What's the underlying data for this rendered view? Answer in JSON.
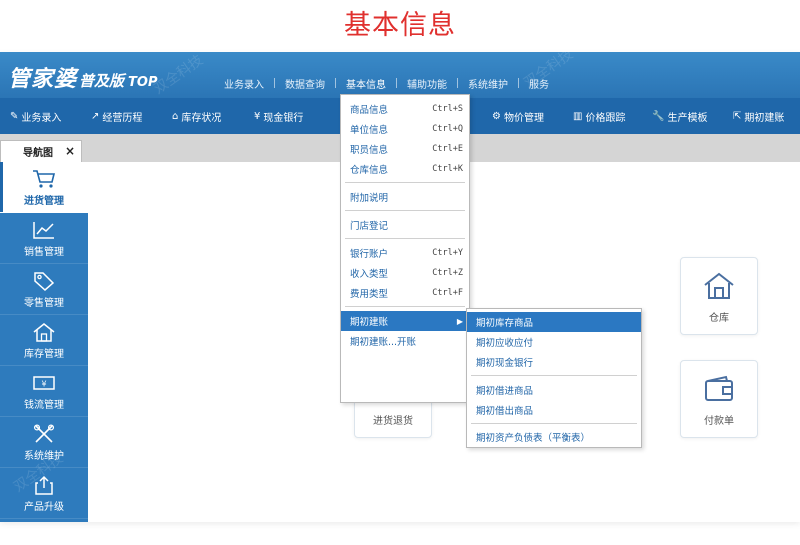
{
  "caption": "基本信息",
  "brand": {
    "main": "管家婆",
    "sub": "普及版",
    "top": "TOP"
  },
  "menubar": [
    "业务录入",
    "数据查询",
    "基本信息",
    "辅助功能",
    "系统维护",
    "服务"
  ],
  "toolbar": [
    {
      "label": "业务录入",
      "icon": "business-entry-icon"
    },
    {
      "label": "经营历程",
      "icon": "trend-icon"
    },
    {
      "label": "库存状况",
      "icon": "home-icon"
    },
    {
      "label": "现金银行",
      "icon": "yen-icon"
    },
    {
      "label": "物价管理",
      "icon": "gear-icon"
    },
    {
      "label": "价格跟踪",
      "icon": "bar-chart-icon"
    },
    {
      "label": "生产模板",
      "icon": "wrench-icon"
    },
    {
      "label": "期初建账",
      "icon": "export-icon"
    }
  ],
  "tab": {
    "label": "导航图",
    "close": "×"
  },
  "sidebar": [
    {
      "label": "进货管理",
      "icon": "cart-icon"
    },
    {
      "label": "销售管理",
      "icon": "line-chart-icon"
    },
    {
      "label": "零售管理",
      "icon": "tag-icon"
    },
    {
      "label": "库存管理",
      "icon": "house-icon"
    },
    {
      "label": "钱流管理",
      "icon": "banknote-icon"
    },
    {
      "label": "系统维护",
      "icon": "tools-icon"
    },
    {
      "label": "产品升级",
      "icon": "upload-icon"
    }
  ],
  "cards": [
    {
      "label": "进货退货",
      "icon": "return-doc-icon"
    },
    {
      "label": "仓库",
      "icon": "warehouse-icon"
    },
    {
      "label": "付款单",
      "icon": "wallet-icon"
    }
  ],
  "basic_info_menu": [
    {
      "label": "商品信息",
      "shortcut": "Ctrl+S"
    },
    {
      "label": "单位信息",
      "shortcut": "Ctrl+Q"
    },
    {
      "label": "职员信息",
      "shortcut": "Ctrl+E"
    },
    {
      "label": "仓库信息",
      "shortcut": "Ctrl+K"
    },
    {
      "label": "附加说明",
      "shortcut": ""
    },
    {
      "label": "门店登记",
      "shortcut": ""
    },
    {
      "label": "银行账户",
      "shortcut": "Ctrl+Y"
    },
    {
      "label": "收入类型",
      "shortcut": "Ctrl+Z"
    },
    {
      "label": "费用类型",
      "shortcut": "Ctrl+F"
    },
    {
      "label": "期初建账",
      "shortcut": ""
    },
    {
      "label": "期初建账...开账",
      "shortcut": ""
    }
  ],
  "submenu": [
    "期初库存商品",
    "期初应收应付",
    "期初现金银行",
    "期初借进商品",
    "期初借出商品",
    "期初资产负债表（平衡表）"
  ],
  "watermark": "双全科技",
  "colors": {
    "accent": "#1f67aa",
    "topbar": "#2b75b5",
    "highlight": "#2b78c2",
    "caption": "#e0302e"
  }
}
